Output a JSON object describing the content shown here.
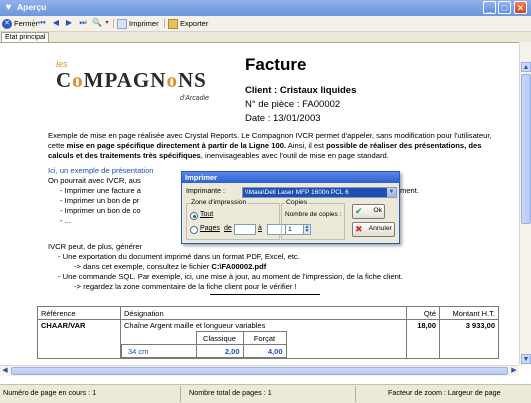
{
  "window": {
    "title": "Aperçu"
  },
  "toolbar": {
    "close": "Fermer",
    "print": "Imprimer",
    "export": "Exporter"
  },
  "tabs": [
    "Etat principal"
  ],
  "report": {
    "logo_les": "les",
    "logo_name_a": "C",
    "logo_name_b": "MPAGN",
    "logo_name_c": "N",
    "logo_name_d": "S",
    "logo_sub": "d'Arcadie",
    "title": "Facture",
    "client": "Client : Cristaux liquides",
    "piece": "N° de pièce : FA00002",
    "date": "Date : 13/01/2003",
    "para1_a": "Exemple de mise en page réalisée avec Crystal Reports. Le Compagnon IVCR permet d'appeler, sans modification pour l'utilisateur, cette ",
    "para1_b": "mise en page spécifique directement à partir de la Ligne 100.",
    "para1_c": " Ainsi, il est ",
    "para1_d": "possible de réaliser des présentations, des calculs et des traitements très spécifiques",
    "para1_e": ", inenvisageables avec l'outil de mise en page standard.",
    "ex_link": "Ici, un exemple de présentation",
    "ex_line2": "On pourrait avec IVCR, aus",
    "ex_b1": "- Imprimer une facture a",
    "ex_b1_end": "ment.",
    "ex_b2": "- Imprimer un bon de pr",
    "ex_b3": "- Imprimer un bon de co",
    "ex_b4": "- ...",
    "ivcr_line": "IVCR peut, de plus, générer",
    "ivcr_b1": "- Une exportation du document imprimé dans un format PDF, Excel, etc.",
    "ivcr_b2a": "-> dans cet exemple, consultez le fichier ",
    "ivcr_b2b": "C:\\FA00002.pdf",
    "ivcr_b3": "- Une commande SQL. Par exemple, ici, une mise à jour, au moment de l'impression, de la fiche client.",
    "ivcr_b4": "-> regardez la zone commentaire de la fiche client pour le vérifier !"
  },
  "table": {
    "headers": [
      "Référence",
      "Désignation",
      "Qté",
      "Montant H.T."
    ],
    "row1": {
      "ref": "CHAAR/VAR",
      "desig": "Chaîne Argent maille et longueur variables",
      "qty": "18,00",
      "amount": "3 933,00"
    },
    "sub_headers": [
      "Classique",
      "Forçat"
    ],
    "sub_row1": {
      "label": "34 cm",
      "classique": "2,00",
      "forcat": "4,00"
    }
  },
  "dialog": {
    "title": "Imprimer",
    "printer_label": "Imprimante :",
    "printer_value": "\\\\Maia\\Dell Laser MFP 1600n PCL 6",
    "zone_label": "Zone d'impression",
    "all_label": "Tout",
    "pages_label": "Pages",
    "from_label": "de",
    "to_label": "à",
    "copies_group": "Copies",
    "copies_label": "Nombre de copies :",
    "copies_value": "1",
    "ok_label": "Ok",
    "cancel_label": "Annuler"
  },
  "status": {
    "page_current": "Numéro de page en cours : 1",
    "page_total": "Nombre total de pages : 1",
    "zoom": "Facteur de zoom : Largeur de page"
  },
  "colors": {
    "titlebar": "#6c96dd",
    "link": "#1f4fb5",
    "accent": "#e0902a"
  }
}
